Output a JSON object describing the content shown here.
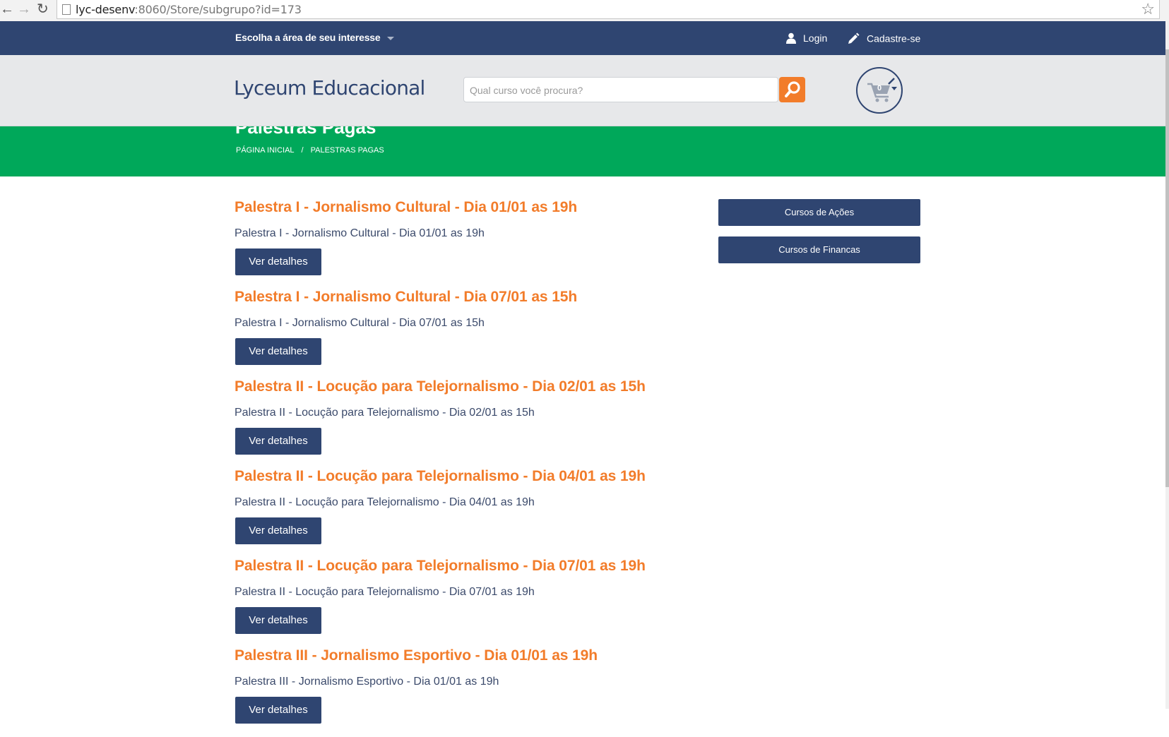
{
  "browser": {
    "url_host": "lyc-desenv",
    "url_rest": ":8060/Store/subgrupo?id=173"
  },
  "topnav": {
    "area_label": "Escolha a área de seu interesse",
    "login_label": "Login",
    "signup_label": "Cadastre-se"
  },
  "header": {
    "logo": "Lyceum Educacional",
    "search_placeholder": "Qual curso você procura?",
    "cart_count": "0"
  },
  "banner": {
    "title": "Palestras Pagas",
    "breadcrumb": [
      "PÁGINA INICIAL",
      "PALESTRAS PAGAS"
    ],
    "separator": "/"
  },
  "courses": [
    {
      "title": "Palestra I - Jornalismo Cultural - Dia 01/01 as 19h",
      "subtitle": "Palestra I - Jornalismo Cultural - Dia 01/01 as 19h",
      "button": "Ver detalhes"
    },
    {
      "title": "Palestra I - Jornalismo Cultural - Dia 07/01 as 15h",
      "subtitle": "Palestra I - Jornalismo Cultural - Dia 07/01 as 15h",
      "button": "Ver detalhes"
    },
    {
      "title": "Palestra II - Locução para Telejornalismo - Dia 02/01 as 15h",
      "subtitle": "Palestra II - Locução para Telejornalismo - Dia 02/01 as 15h",
      "button": "Ver detalhes"
    },
    {
      "title": "Palestra II - Locução para Telejornalismo - Dia 04/01 as 19h",
      "subtitle": "Palestra II - Locução para Telejornalismo - Dia 04/01 as 19h",
      "button": "Ver detalhes"
    },
    {
      "title": "Palestra II - Locução para Telejornalismo - Dia 07/01 as 19h",
      "subtitle": "Palestra II - Locução para Telejornalismo - Dia 07/01 as 19h",
      "button": "Ver detalhes"
    },
    {
      "title": "Palestra III - Jornalismo Esportivo - Dia 01/01 as 19h",
      "subtitle": "Palestra III - Jornalismo Esportivo - Dia 01/01 as 19h",
      "button": "Ver detalhes"
    }
  ],
  "sidebar": {
    "buttons": [
      "Cursos de Ações",
      "Cursos de Financas"
    ]
  },
  "icons": {
    "back": "back-arrow-icon",
    "forward": "forward-arrow-icon",
    "reload": "reload-icon",
    "star": "bookmark-star-icon",
    "user": "user-icon",
    "pencil": "pencil-icon",
    "search": "search-icon",
    "cart": "shopping-cart-icon"
  },
  "colors": {
    "navy": "#2f4571",
    "orange": "#f27c2a",
    "green": "#00a85a",
    "header_gray": "#e7e8ea"
  }
}
